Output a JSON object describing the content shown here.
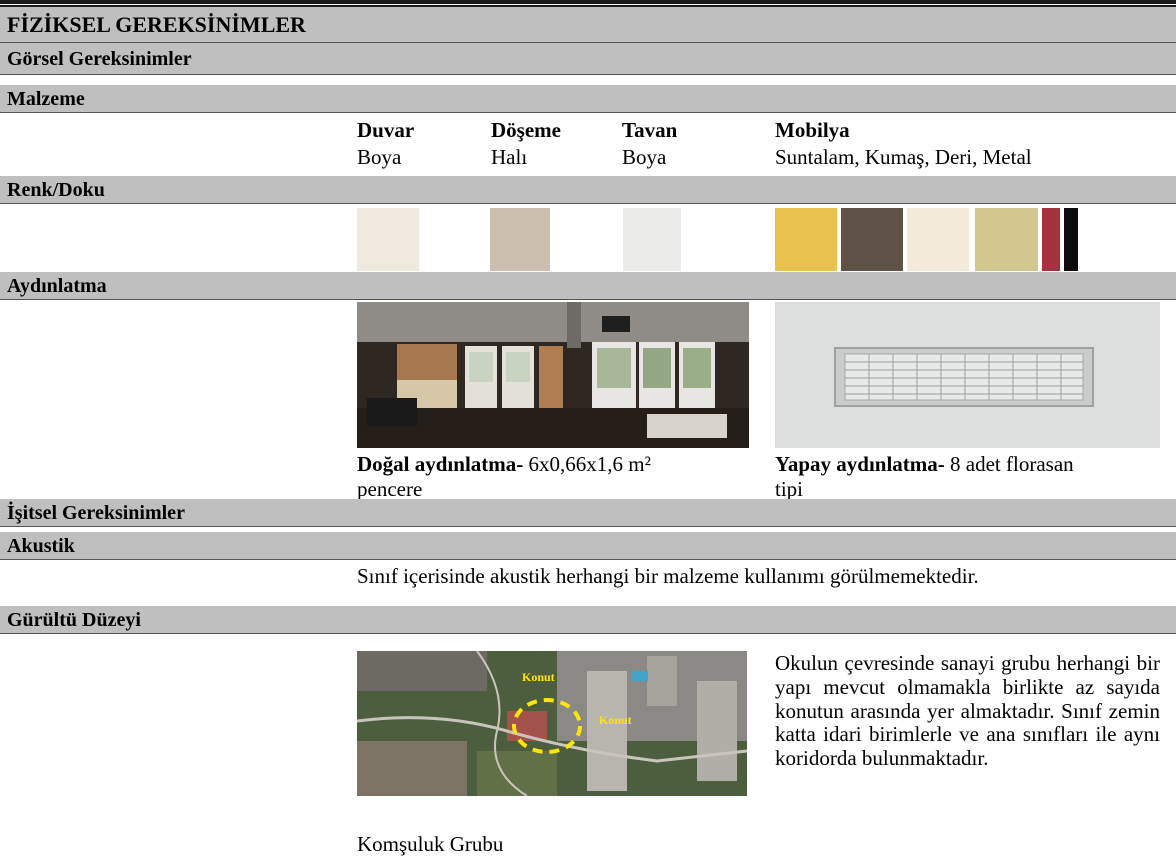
{
  "title": "FİZİKSEL GEREKSİNİMLER",
  "visual": {
    "heading": "Görsel Gereksinimler",
    "material": {
      "heading": "Malzeme",
      "columns": [
        {
          "label": "Duvar",
          "value": "Boya"
        },
        {
          "label": "Döşeme",
          "value": "Halı"
        },
        {
          "label": "Tavan",
          "value": "Boya"
        },
        {
          "label": "Mobilya",
          "value": "Suntalam, Kumaş, Deri, Metal"
        }
      ]
    },
    "color": {
      "heading": "Renk/Doku",
      "swatches": [
        "#efe9e0",
        "#cdbfb0",
        "#ebebea",
        "#e8c24c",
        "#5e5247",
        "#f4ead8",
        "#d2c78f",
        "#a5333d",
        "#0c0c0c"
      ]
    },
    "lighting": {
      "heading": "Aydınlatma",
      "natural_label": "Doğal aydınlatma-",
      "natural_text_line1": "6x0,66x1,6 m²",
      "natural_text_line2": "pencere",
      "artificial_label": "Yapay aydınlatma-",
      "artificial_text_line1": "8 adet florasan",
      "artificial_text_line2": "tipi"
    }
  },
  "auditory": {
    "heading": "İşitsel Gereksinimler",
    "acoustic": {
      "heading": "Akustik",
      "text": "Sınıf içerisinde akustik herhangi bir malzeme kullanımı görülmemektedir."
    },
    "noise": {
      "heading": "Gürültü Düzeyi",
      "map_labels": [
        "Konut",
        "Konut"
      ],
      "caption": "Komşuluk Grubu",
      "text": "Okulun çevresinde sanayi grubu herhangi bir yapı mevcut olmamakla birlikte az sayıda konutun arasında yer almaktadır. Sınıf zemin katta idari birimlerle ve ana sınıfları ile aynı koridorda bulunmaktadır."
    }
  }
}
